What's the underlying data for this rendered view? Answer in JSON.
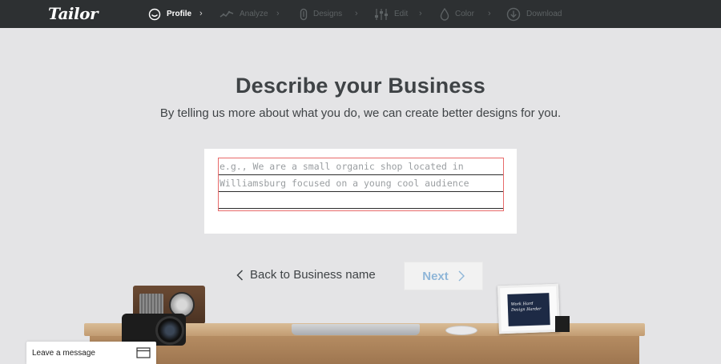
{
  "brand": {
    "logo": "Tailor"
  },
  "steps": [
    {
      "label": "Profile",
      "icon": "smiley-face-icon",
      "active": true
    },
    {
      "label": "Analyze",
      "icon": "pulse-line-icon",
      "active": false
    },
    {
      "label": "Designs",
      "icon": "paperclip-icon",
      "active": false
    },
    {
      "label": "Edit",
      "icon": "sliders-icon",
      "active": false
    },
    {
      "label": "Color",
      "icon": "drop-icon",
      "active": false
    },
    {
      "label": "Download",
      "icon": "download-circle-icon",
      "active": false
    }
  ],
  "hero": {
    "title": "Describe your Business",
    "subtitle": "By telling us more about what you do, we can create better designs for you."
  },
  "description": {
    "placeholder_line1": "e.g., We are a small organic shop located in",
    "placeholder_line2": "Williamsburg focused on a young cool audience",
    "value": ""
  },
  "nav": {
    "back_label": "Back to Business name",
    "next_label": "Next"
  },
  "scene": {
    "frame_text_line1": "Work Hard",
    "frame_text_line2": "Design Harder"
  },
  "chat": {
    "label": "Leave a message",
    "icon": "chat-window-icon"
  },
  "colors": {
    "topbar": "#2d3032",
    "accent": "#e86a6a",
    "next_text": "#8fb6d8"
  }
}
